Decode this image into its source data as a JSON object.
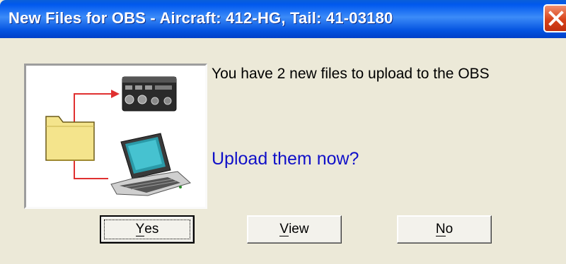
{
  "window": {
    "title": "New Files for OBS - Aircraft: 412-HG, Tail: 41-03180"
  },
  "message": {
    "line": "You have 2 new files to upload to the OBS",
    "question": "Upload them now?"
  },
  "buttons": {
    "yes": {
      "first": "Y",
      "rest": "es"
    },
    "view": {
      "first": "V",
      "rest": "iew"
    },
    "no": {
      "first": "N",
      "rest": "o"
    }
  },
  "colors": {
    "title_bar": "#0058ee",
    "question_text": "#1010c8",
    "close_button": "#d8431a",
    "arrow": "#e03030",
    "folder": "#f4e48c"
  },
  "icons": [
    "folder-icon",
    "obs-unit-icon",
    "laptop-icon",
    "arrow-icon"
  ]
}
